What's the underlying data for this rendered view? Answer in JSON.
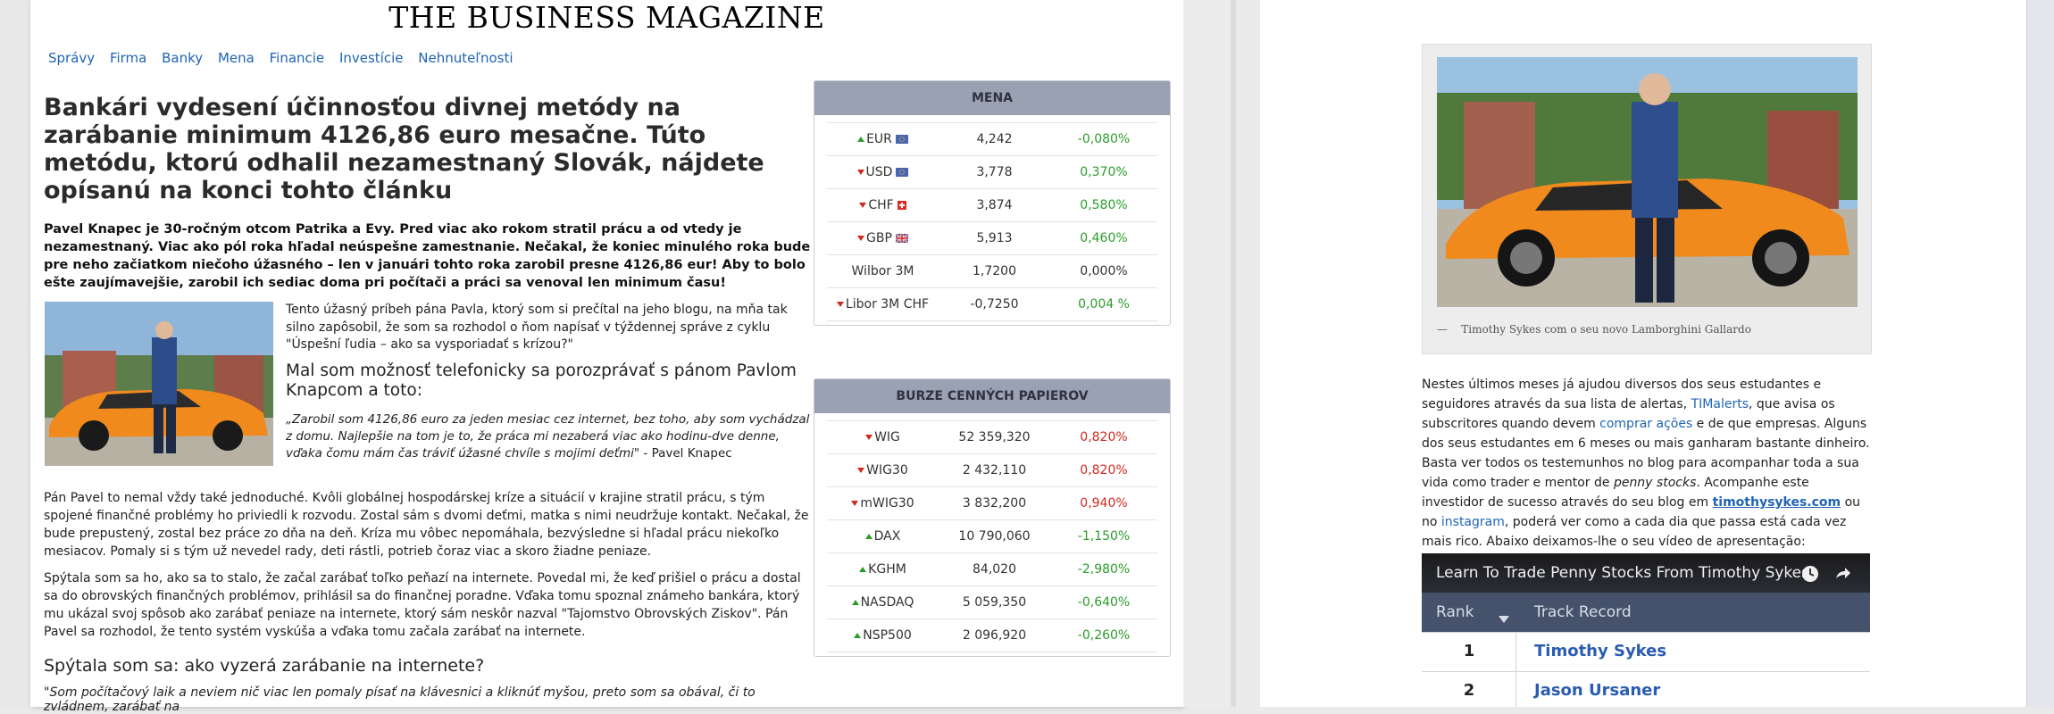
{
  "masthead": "THE BUSINESS MAGAZINE",
  "nav": [
    "Správy",
    "Firma",
    "Banky",
    "Mena",
    "Financie",
    "Investície",
    "Nehnuteľnosti"
  ],
  "article": {
    "headline": "Bankári vydesení účinnosťou divnej metódy na zarábanie minimum 4126,86 euro mesačne. Túto metódu, ktorú odhalil nezamestnaný Slovák, nájdete opísanú na konci tohto článku",
    "lead": "Pavel Knapec je 30-ročným otcom Patrika a Evy. Pred viac ako rokom stratil prácu a od vtedy je nezamestnaný. Viac ako pól roka hľadal neúspešne zamestnanie. Nečakal, že koniec minulého roka bude pre neho začiatkom niečoho úžasného – len v januári tohto roka zarobil presne 4126,86 eur! Aby to bolo ešte zaujímavejšie, zarobil ich sediac doma pri počítači a práci sa venoval len minimum času!",
    "intro": "Tento úžasný príbeh pána Pavla, ktorý som si prečítal na jeho blogu, na mňa tak silno zapôsobil, že som sa rozhodol o ňom napísať v týždennej správe z cyklu \"Úspešní ľudia – ako sa vysporiadať s krízou?\"",
    "subhead": "Mal som možnosť telefonicky sa porozprávať s pánom Pavlom Knapcom a toto:",
    "quote": "„Zarobil som 4126,86 euro za jeden mesiac cez internet, bez toho, aby som vychádzal z domu. Najlepšie na tom je to, že práca mi nezaberá viac ako hodinu-dve denne, vďaka čomu mám čas tráviť úžasné chvíle s mojimi deťmi\"",
    "quote_author": " - Pavel Knapec",
    "p1": "Pán Pavel to nemal vždy také jednoduché. Kvôli globálnej hospodárskej kríze a situácií v krajine stratil prácu, s tým spojené finančné problémy ho priviedli k rozvodu. Zostal sám s dvomi deťmi, matka s nimi neudržuje kontakt. Nečakal, že bude prepustený, zostal bez práce zo dňa na deň. Kríza mu vôbec nepomáhala, bezvýsledne si hľadal prácu niekoľko mesiacov. Pomaly si s tým už nevedel rady, deti rástli, potrieb čoraz viac a skoro žiadne peniaze.",
    "p2": "Spýtala som sa ho, ako sa to stalo, že začal zarábať toľko peňazí na internete. Povedal mi, že keď prišiel o prácu a dostal sa do obrovských finančných problémov, prihlásil sa do finančnej poradne. Vďaka tomu spoznal známeho bankára, ktorý mu ukázal svoj spôsob ako zarábať peniaze na internete, ktorý sám neskôr nazval \"Tajomstvo Obrovských Ziskov\". Pán Pavel sa rozhodol, že tento systém vyskúša a vďaka tomu začala zarábať na internete.",
    "h2": "Spýtala som sa: ako vyzerá zarábanie na internete?",
    "p3": "\"Som počítačový laik a neviem nič viac len pomaly písať na klávesnici a kliknúť myšou, preto som sa obával, či to zvládnem, zarábať na"
  },
  "mena": {
    "title": "MENA",
    "rows": [
      {
        "name": "EUR",
        "dir": "up",
        "flag": "eu",
        "value": "4,242",
        "change": "-0,080%",
        "color": "up"
      },
      {
        "name": "USD",
        "dir": "dn",
        "flag": "eu",
        "value": "3,778",
        "change": "0,370%",
        "color": "up"
      },
      {
        "name": "CHF",
        "dir": "dn",
        "flag": "ch",
        "value": "3,874",
        "change": "0,580%",
        "color": "up"
      },
      {
        "name": "GBP",
        "dir": "dn",
        "flag": "gb",
        "value": "5,913",
        "change": "0,460%",
        "color": "up"
      },
      {
        "name": "Wilbor 3M",
        "dir": "none",
        "flag": "",
        "value": "1,7200",
        "change": "0,000%",
        "color": "neutral"
      },
      {
        "name": "Libor 3M CHF",
        "dir": "dn",
        "flag": "",
        "value": "-0,7250",
        "change": "0,004 %",
        "color": "up"
      }
    ]
  },
  "burze": {
    "title": "BURZE CENNÝCH PAPIEROV",
    "rows": [
      {
        "name": "WIG",
        "dir": "dn",
        "value": "52 359,320",
        "change": "0,820%",
        "color": "dn"
      },
      {
        "name": "WIG30",
        "dir": "dn",
        "value": "2 432,110",
        "change": "0,820%",
        "color": "dn"
      },
      {
        "name": "mWIG30",
        "dir": "dn",
        "value": "3 832,200",
        "change": "0,940%",
        "color": "dn"
      },
      {
        "name": "DAX",
        "dir": "up",
        "value": "10 790,060",
        "change": "-1,150%",
        "color": "up"
      },
      {
        "name": "KGHM",
        "dir": "up",
        "value": "84,020",
        "change": "-2,980%",
        "color": "up"
      },
      {
        "name": "NASDAQ",
        "dir": "up",
        "value": "5 059,350",
        "change": "-0,640%",
        "color": "up"
      },
      {
        "name": "NSP500",
        "dir": "up",
        "value": "2 096,920",
        "change": "-0,260%",
        "color": "up"
      }
    ]
  },
  "right": {
    "caption": "Timothy Sykes com o seu novo Lamborghini Gallardo",
    "t1": "Nestes últimos meses já ajudou diversos dos seus estudantes e seguidores através da sua lista de alertas, ",
    "link1": "TIMalerts",
    "t2": ", que avisa os subscritores quando devem ",
    "link2": "comprar ações",
    "t3": " e de que empresas. Alguns dos seus estudantes em 6 meses ou mais ganharam bastante dinheiro. Basta ver todos os testemunhos no blog para acompanhar toda a sua vida como trader e mentor de ",
    "em1": "penny stocks",
    "t4": ". Acompanhe este investidor de sucesso através do seu blog em ",
    "link3": "timothysykes.com",
    "t5": " ou no ",
    "link4": "instagram",
    "t6": ", poderá ver como a cada dia que passa está cada vez mais rico. Abaixo deixamos-lhe o seu vídeo de apresentação:",
    "video_title": "Learn To Trade Penny Stocks From Timothy Sykes",
    "col_rank": "Rank",
    "col_record": "Track Record",
    "ranks": [
      {
        "rank": "1",
        "name": "Timothy Sykes"
      },
      {
        "rank": "2",
        "name": "Jason Ursaner"
      }
    ]
  }
}
